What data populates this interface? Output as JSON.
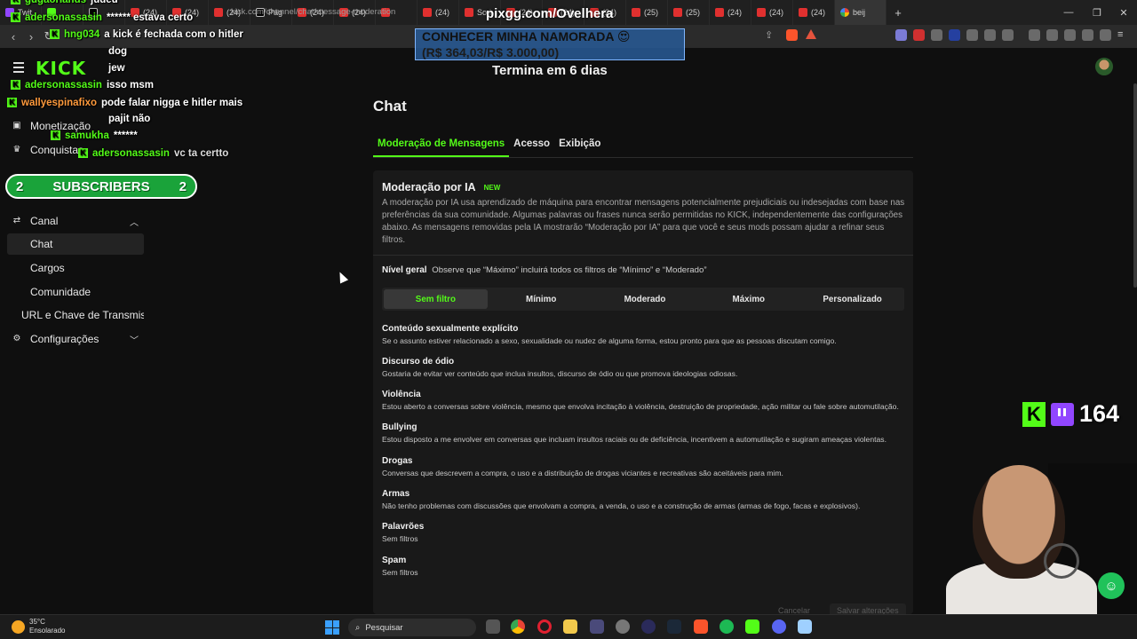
{
  "browser": {
    "tabs": [
      {
        "label": "Twit",
        "icon": "twitch-icon"
      },
      {
        "label": "",
        "icon": "kick-icon"
      },
      {
        "label": "",
        "icon": "x-icon"
      },
      {
        "label": "(24)",
        "icon": "youtube-icon"
      },
      {
        "label": "(24)",
        "icon": "youtube-icon"
      },
      {
        "label": "(24)",
        "icon": "youtube-icon"
      },
      {
        "label": "Pág",
        "icon": "x-icon"
      },
      {
        "label": "(24)",
        "icon": "youtube-icon"
      },
      {
        "label": "(24)",
        "icon": "youtube-icon"
      },
      {
        "label": "",
        "icon": "youtube-icon"
      },
      {
        "label": "(24)",
        "icon": "youtube-icon"
      },
      {
        "label": "Sori",
        "icon": "youtube-icon"
      },
      {
        "label": "(24)",
        "icon": "youtube-icon"
      },
      {
        "label": "(24)",
        "icon": "youtube-icon"
      },
      {
        "label": "(24)",
        "icon": "youtube-icon"
      },
      {
        "label": "(25)",
        "icon": "youtube-icon"
      },
      {
        "label": "(25)",
        "icon": "youtube-icon"
      },
      {
        "label": "(24)",
        "icon": "youtube-icon"
      },
      {
        "label": "(24)",
        "icon": "youtube-icon"
      },
      {
        "label": "(24)",
        "icon": "youtube-icon"
      },
      {
        "label": "beij",
        "icon": "google-icon"
      }
    ],
    "url": "kick.com/channel/chat/message-moderation"
  },
  "page": {
    "countdown": "Termina em 6 dias",
    "chat_title": "Chat",
    "tabs": [
      "Moderação de Mensagens",
      "Acesso",
      "Exibição"
    ]
  },
  "sidebar": {
    "items": [
      {
        "label": "Monetização",
        "icon": "wallet-icon"
      },
      {
        "label": "Conquistas",
        "icon": "trophy-icon"
      },
      {
        "label": "Canal",
        "icon": "shuffle-icon",
        "expanded": true
      },
      {
        "label": "Chat",
        "active": true
      },
      {
        "label": "Cargos"
      },
      {
        "label": "Comunidade"
      },
      {
        "label": "URL e Chave de Transmissão"
      },
      {
        "label": "Configurações",
        "icon": "gear-icon",
        "expanded": false
      }
    ]
  },
  "moderation": {
    "title": "Moderação por IA",
    "badge": "NEW",
    "description": "A moderação por IA usa aprendizado de máquina para encontrar mensagens potencialmente prejudiciais ou indesejadas com base nas preferências da sua comunidade. Algumas palavras ou frases nunca serão permitidas no KICK, independentemente das configurações abaixo. As mensagens removidas pela IA mostrarão “Moderação por IA” para que você e seus mods possam ajudar a refinar seus filtros.",
    "level_label": "Nível geral",
    "level_hint": "Observe que “Máximo” incluirá todos os filtros de “Mínimo” e “Moderado”",
    "levels": [
      "Sem filtro",
      "Mínimo",
      "Moderado",
      "Máximo",
      "Personalizado"
    ],
    "selected_level": "Sem filtro",
    "filters": [
      {
        "title": "Conteúdo sexualmente explícito",
        "desc": "Se o assunto estiver relacionado a sexo, sexualidade ou nudez de alguma forma, estou pronto para que as pessoas discutam comigo."
      },
      {
        "title": "Discurso de ódio",
        "desc": "Gostaria de evitar ver conteúdo que inclua insultos, discurso de ódio ou que promova ideologias odiosas."
      },
      {
        "title": "Violência",
        "desc": "Estou aberto a conversas sobre violência, mesmo que envolva incitação à violência, destruição de propriedade, ação militar ou fale sobre automutilação."
      },
      {
        "title": "Bullying",
        "desc": "Estou disposto a me envolver em conversas que incluam insultos raciais ou de deficiência, incentivem a automutilação e sugiram ameaças violentas."
      },
      {
        "title": "Drogas",
        "desc": "Conversas que descrevem a compra, o uso e a distribuição de drogas viciantes e recreativas são aceitáveis para mim."
      },
      {
        "title": "Armas",
        "desc": "Não tenho problemas com discussões que envolvam a compra, a venda, o uso e a construção de armas (armas de fogo, facas e explosivos)."
      },
      {
        "title": "Palavrões",
        "desc": "Sem filtros"
      },
      {
        "title": "Spam",
        "desc": "Sem filtros"
      }
    ],
    "cancel_label": "Cancelar",
    "save_label": "Salvar alterações"
  },
  "overlay": {
    "chat": [
      {
        "user": "gugaorlands",
        "msg": "judeu"
      },
      {
        "user": "adersonassasin",
        "msg": "****** estava certo"
      },
      {
        "user": "hng034",
        "msg": "a kick é fechada com o hitler"
      },
      {
        "user": "",
        "msg": "dog"
      },
      {
        "user": "",
        "msg": "jew"
      },
      {
        "user": "adersonassasin",
        "msg": "isso msm"
      },
      {
        "user": "wallyespinafixo",
        "msg": "pode falar nigga e hitler mais"
      },
      {
        "user": "",
        "msg": "pajit não"
      },
      {
        "user": "samukha",
        "msg": "******"
      },
      {
        "user": "adersonassasin",
        "msg": "vc ta certto"
      }
    ],
    "pix_url": "pixgg.com/Ovelhera",
    "goal_title": "CONHECER MINHA NAMORADA 😍",
    "goal_progress": "(R$ 364,03/R$ 3.000,00)",
    "subscribers_label": "SUBSCRIBERS",
    "subscribers_left": "2",
    "subscribers_right": "2",
    "viewers": "164"
  },
  "taskbar": {
    "temperature": "35°C",
    "condition": "Ensolarado",
    "search_placeholder": "Pesquisar"
  },
  "colors": {
    "accent": "#53fc18",
    "panel": "#191919",
    "background": "#0f0f0f"
  }
}
